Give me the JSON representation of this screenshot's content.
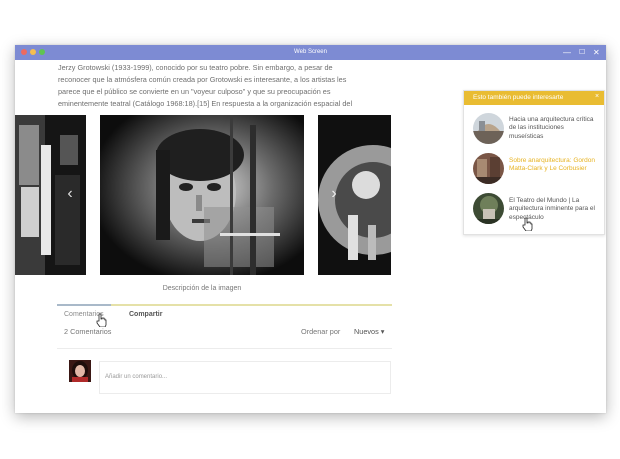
{
  "window": {
    "title": "Web Screen"
  },
  "article": {
    "lines": [
      "Jerzy Grotowski (1933-1999), conocido por su teatro pobre. Sin embargo, a pesar de",
      "reconocer que la atmósfera común creada por Grotowski es interesante, a los artistas les",
      "parece que el público se convierte en un \"voyeur culposo\" y que su preocupación es",
      "eminentemente teatral (Catálogo 1968:18).[15] En respuesta a la organización espacial del"
    ]
  },
  "gallery": {
    "caption": "Descripción de la imagen",
    "prev_icon": "chevron-left-icon",
    "next_icon": "chevron-right-icon",
    "prev_glyph": "‹",
    "next_glyph": "›"
  },
  "comments": {
    "tabs": [
      "Comentarios",
      "Compartir"
    ],
    "count_label": "2 Comentarios",
    "sort_label": "Ordenar por",
    "sort_value": "Nuevos ▾",
    "input_placeholder": "Añadir un comentario..."
  },
  "sidebar": {
    "title": "Esto también puede interesarte",
    "close_glyph": "×",
    "items": [
      {
        "text": "Hacia una arquitectura crítica de las instituciones museísticas"
      },
      {
        "text": "Sobre anarquitectura: Gordon Matta-Clark y Le Corbusier"
      },
      {
        "text": "El Teatro del Mundo | La arquitectura inminente para el espectáculo"
      }
    ]
  },
  "window_controls": {
    "minimize": "—",
    "maximize": "☐",
    "close": "✕"
  },
  "colors": {
    "titlebar": "#7d8bd3",
    "accent": "#e9bc32",
    "link_highlight": "#e7b322"
  }
}
